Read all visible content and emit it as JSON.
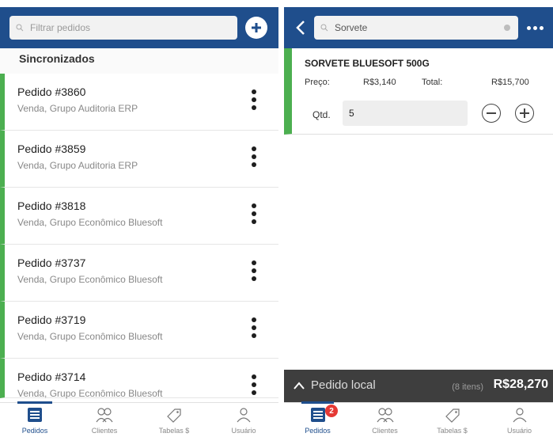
{
  "left": {
    "search": {
      "placeholder": "Filtrar pedidos"
    },
    "section_title": "Sincronizados",
    "orders": [
      {
        "number": "Pedido #3860",
        "subtitle": "Venda, Grupo Auditoria ERP"
      },
      {
        "number": "Pedido #3859",
        "subtitle": "Venda, Grupo Auditoria ERP"
      },
      {
        "number": "Pedido #3818",
        "subtitle": "Venda, Grupo Econômico Bluesoft"
      },
      {
        "number": "Pedido #3737",
        "subtitle": "Venda, Grupo Econômico Bluesoft"
      },
      {
        "number": "Pedido #3719",
        "subtitle": "Venda, Grupo Econômico Bluesoft"
      },
      {
        "number": "Pedido #3714",
        "subtitle": "Venda, Grupo Econômico Bluesoft"
      }
    ]
  },
  "right": {
    "search": {
      "value": "Sorvete"
    },
    "item": {
      "name": "SORVETE BLUESOFT 500G",
      "price_label": "Preço:",
      "price": "R$3,140",
      "total_label": "Total:",
      "total": "R$15,700",
      "qtd_label": "Qtd.",
      "qtd_value": "5"
    },
    "local_order": {
      "label": "Pedido local",
      "count": "(8 itens)",
      "total": "R$28,270"
    },
    "badge": "2"
  },
  "nav": {
    "items": [
      {
        "label": "Pedidos",
        "icon": "orders-icon"
      },
      {
        "label": "Clientes",
        "icon": "clients-icon"
      },
      {
        "label": "Tabelas $",
        "icon": "price-tag-icon"
      },
      {
        "label": "Usuário",
        "icon": "user-icon"
      }
    ]
  },
  "colors": {
    "primary": "#1f4e8c",
    "accent_green": "#4caf50",
    "dark_bar": "#3e3e3e",
    "badge_red": "#e53935"
  }
}
